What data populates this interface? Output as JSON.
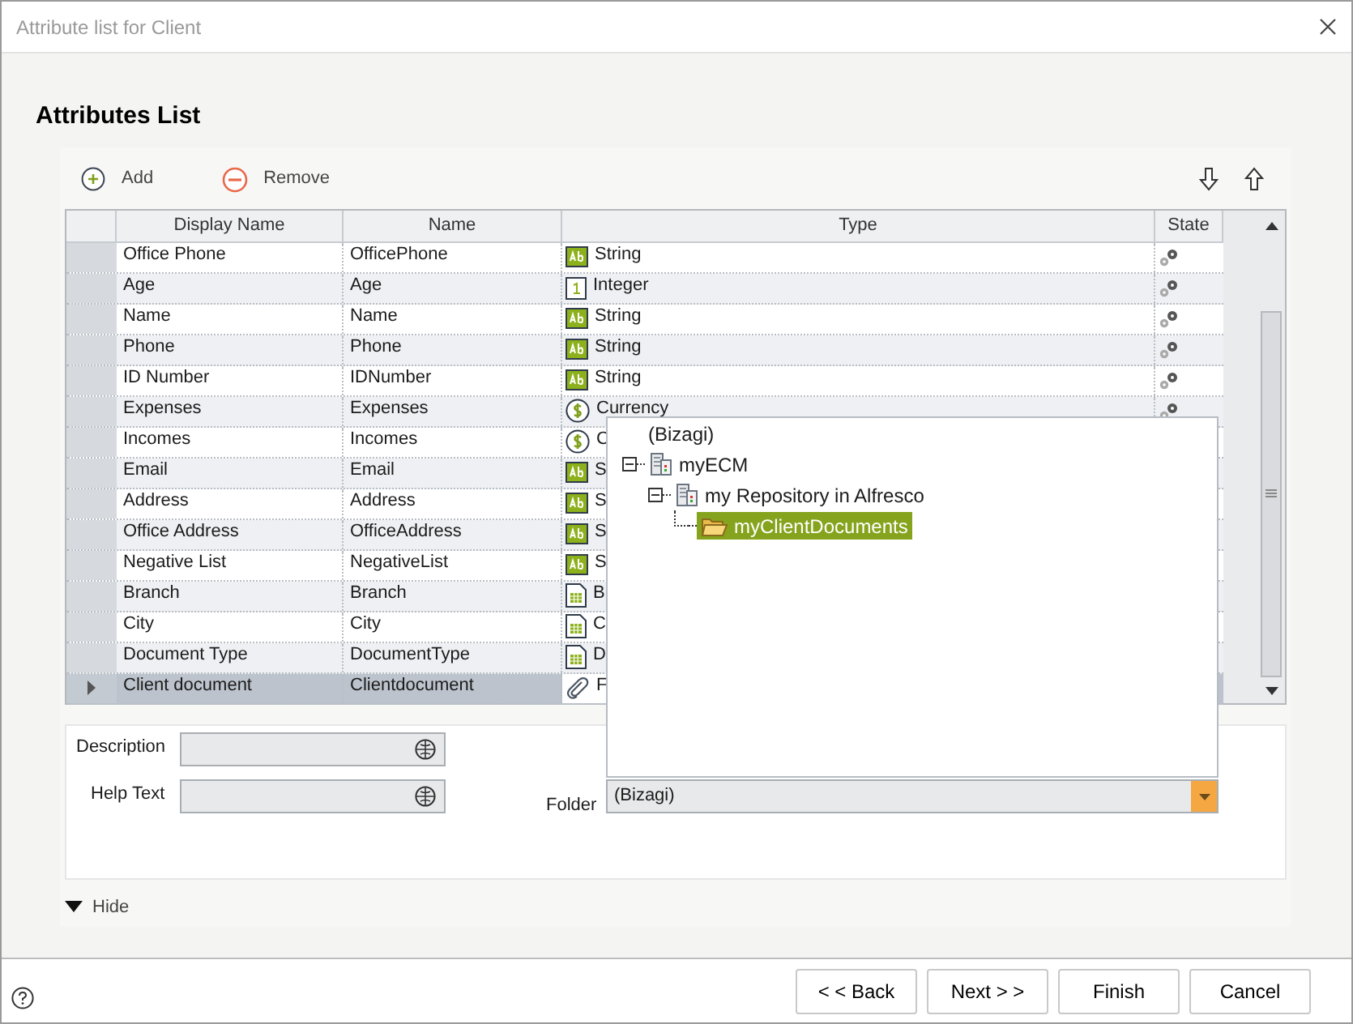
{
  "window": {
    "title": "Attribute list for Client"
  },
  "heading": "Attributes List",
  "toolbar": {
    "add": "Add",
    "remove": "Remove"
  },
  "table": {
    "columns": [
      "Display Name",
      "Name",
      "Type",
      "State"
    ],
    "rows": [
      {
        "display_name": "Office Phone",
        "name": "OfficePhone",
        "type": "String",
        "kind": "string",
        "state_icon": true,
        "selected": false
      },
      {
        "display_name": "Age",
        "name": "Age",
        "type": "Integer",
        "kind": "integer",
        "state_icon": true,
        "selected": false
      },
      {
        "display_name": "Name",
        "name": "Name",
        "type": "String",
        "kind": "string",
        "state_icon": true,
        "selected": false
      },
      {
        "display_name": "Phone",
        "name": "Phone",
        "type": "String",
        "kind": "string",
        "state_icon": true,
        "selected": false
      },
      {
        "display_name": "ID Number",
        "name": "IDNumber",
        "type": "String",
        "kind": "string",
        "state_icon": true,
        "selected": false
      },
      {
        "display_name": "Expenses",
        "name": "Expenses",
        "type": "Currency",
        "kind": "currency",
        "state_icon": true,
        "selected": false
      },
      {
        "display_name": "Incomes",
        "name": "Incomes",
        "type": "C",
        "kind": "currency",
        "state_icon": false,
        "selected": false
      },
      {
        "display_name": "Email",
        "name": "Email",
        "type": "S",
        "kind": "string",
        "state_icon": false,
        "selected": false
      },
      {
        "display_name": "Address",
        "name": "Address",
        "type": "S",
        "kind": "string",
        "state_icon": false,
        "selected": false
      },
      {
        "display_name": "Office Address",
        "name": "OfficeAddress",
        "type": "S",
        "kind": "string",
        "state_icon": false,
        "selected": false
      },
      {
        "display_name": "Negative List",
        "name": "NegativeList",
        "type": "S",
        "kind": "string",
        "state_icon": false,
        "selected": false
      },
      {
        "display_name": "Branch",
        "name": "Branch",
        "type": "B",
        "kind": "entity",
        "state_icon": false,
        "selected": false
      },
      {
        "display_name": "City",
        "name": "City",
        "type": "C",
        "kind": "entity",
        "state_icon": false,
        "selected": false
      },
      {
        "display_name": "Document Type",
        "name": "DocumentType",
        "type": "D",
        "kind": "entity",
        "state_icon": false,
        "selected": false
      },
      {
        "display_name": "Client document",
        "name": "Clientdocument",
        "type": "F",
        "kind": "file",
        "state_icon": false,
        "selected": true
      }
    ]
  },
  "details": {
    "description_label": "Description",
    "help_text_label": "Help Text",
    "folder_label": "Folder",
    "folder_value": "(Bizagi)"
  },
  "folder_dropdown": {
    "root": "(Bizagi)",
    "tree": [
      {
        "label": "myECM",
        "expanded": true,
        "selected": false,
        "children": [
          {
            "label": "my Repository in Alfresco",
            "expanded": true,
            "selected": false,
            "children": [
              {
                "label": "myClientDocuments",
                "selected": true
              }
            ]
          }
        ]
      }
    ]
  },
  "hide_toggle": "Hide",
  "buttons": [
    "< < Back",
    "Next > >",
    "Finish",
    "Cancel"
  ]
}
